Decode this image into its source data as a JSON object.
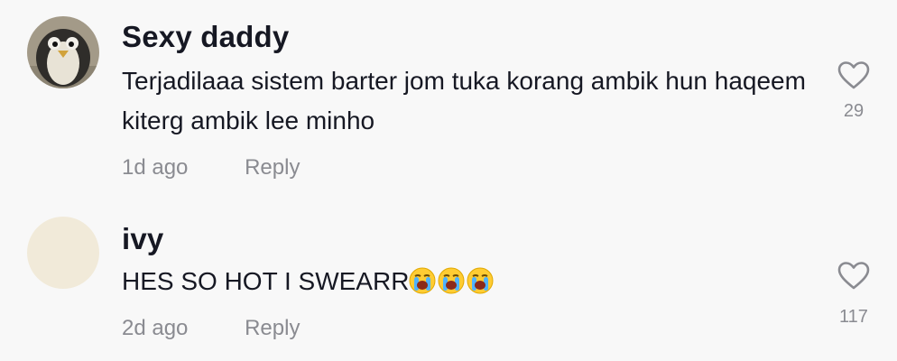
{
  "comments": [
    {
      "username": "Sexy daddy",
      "text": "Terjadilaaa sistem barter jom tuka korang ambik hun haqeem kiterg ambik lee minho",
      "time": "1d ago",
      "reply_label": "Reply",
      "like_count": "29",
      "avatar_icon": "penguin-avatar"
    },
    {
      "username": "ivy",
      "text": "HES SO HOT I SWEARR",
      "emojis": [
        "loudly-crying-face",
        "loudly-crying-face",
        "loudly-crying-face"
      ],
      "time": "2d ago",
      "reply_label": "Reply",
      "like_count": "117",
      "avatar_icon": "blank-avatar"
    }
  ],
  "colors": {
    "background": "#f8f8f8",
    "text_primary": "#161823",
    "text_secondary": "#8a8b91",
    "heart_outline": "#8a8b91"
  }
}
